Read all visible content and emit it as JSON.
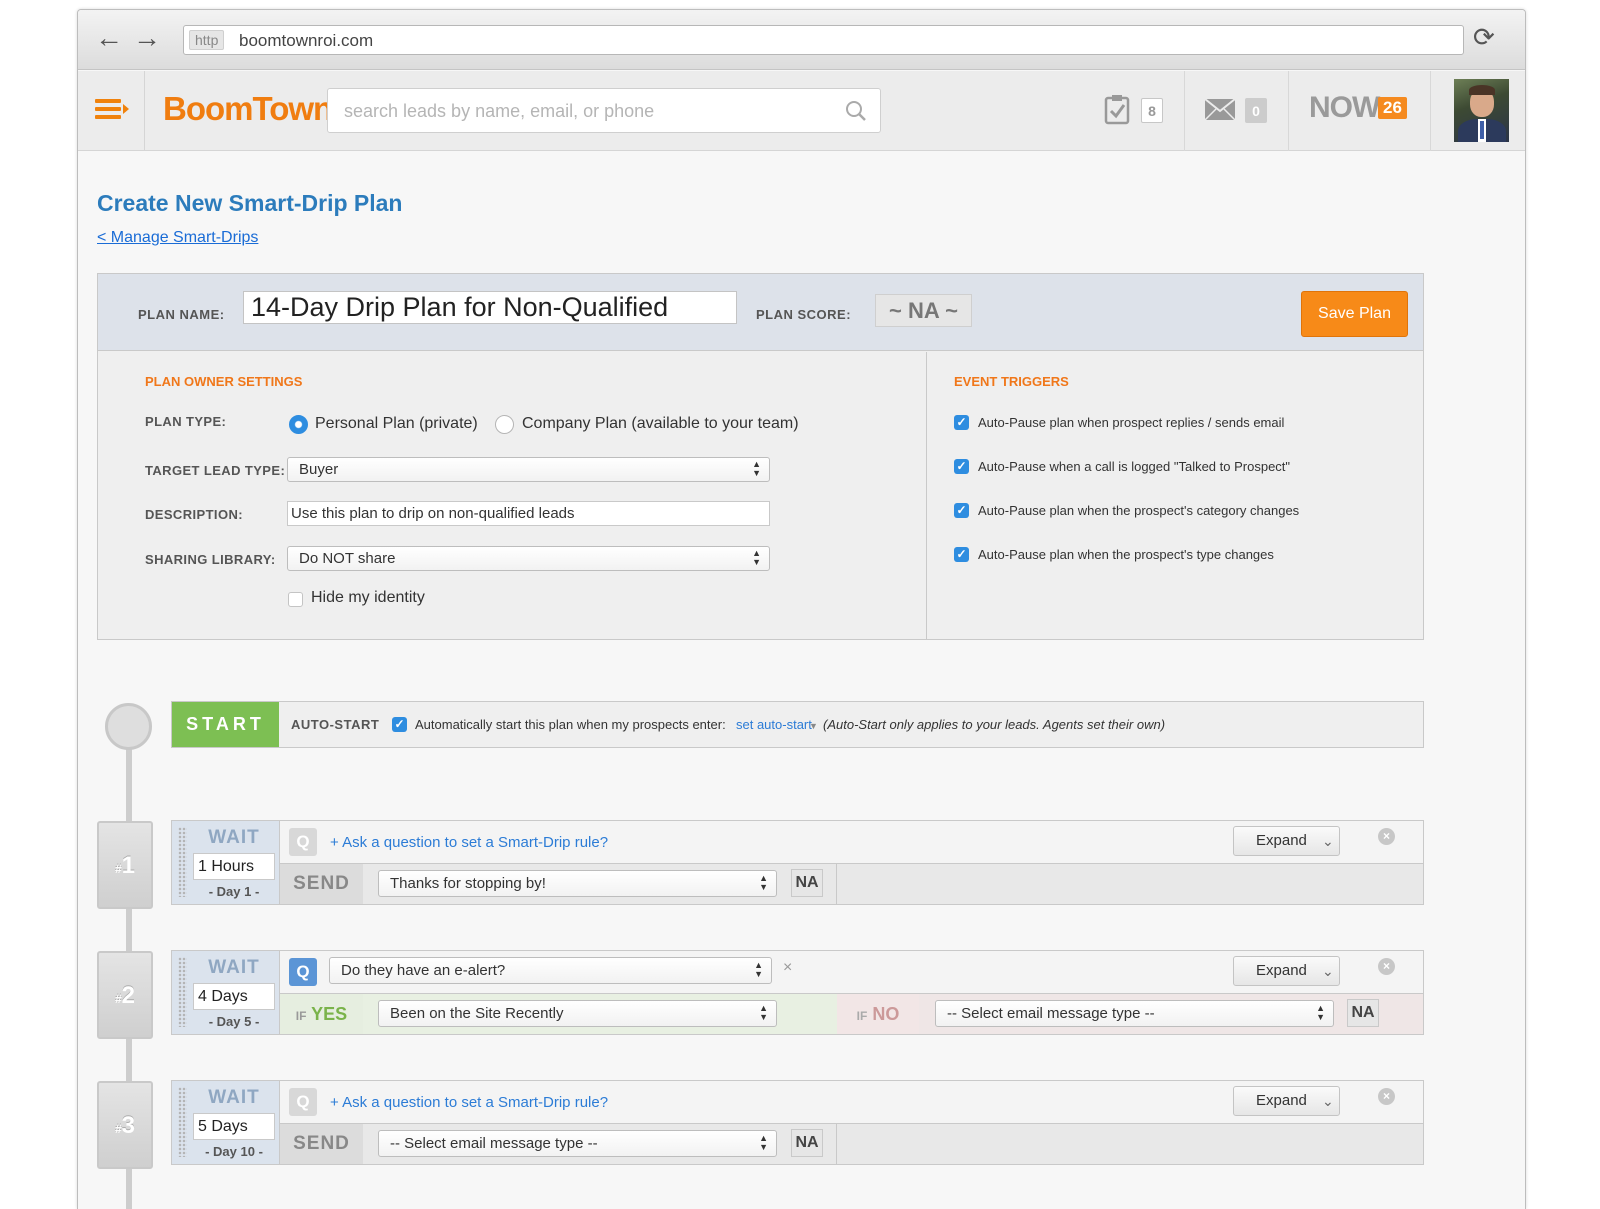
{
  "browser": {
    "protocol": "http",
    "url": "boomtownroi.com",
    "back_icon": "arrow-left",
    "forward_icon": "arrow-right",
    "reload_icon": "reload"
  },
  "header": {
    "logo": "BoomTown!",
    "search_placeholder": "search leads by name, email, or phone",
    "tasks_count": "8",
    "messages_count": "0",
    "now_label": "NOW",
    "now_count": "26"
  },
  "page": {
    "title": "Create New Smart-Drip Plan",
    "back_link": "< Manage Smart-Drips"
  },
  "plan": {
    "name_label": "PLAN NAME:",
    "name_value": "14-Day Drip Plan for Non-Qualified",
    "score_label": "PLAN SCORE:",
    "score_value": "~ NA ~",
    "save_label": "Save Plan"
  },
  "owner_settings": {
    "heading": "PLAN OWNER SETTINGS",
    "plan_type_label": "PLAN TYPE:",
    "plan_type_options": [
      "Personal Plan (private)",
      "Company Plan (available to your team)"
    ],
    "plan_type_selected": 0,
    "target_label": "TARGET LEAD TYPE:",
    "target_value": "Buyer",
    "description_label": "DESCRIPTION:",
    "description_value": "Use this plan to drip on non-qualified leads",
    "sharing_label": "SHARING LIBRARY:",
    "sharing_value": "Do NOT share",
    "hide_identity_label": "Hide my identity",
    "hide_identity_checked": false
  },
  "event_triggers": {
    "heading": "EVENT TRIGGERS",
    "items": [
      {
        "label": "Auto-Pause plan when prospect replies / sends email",
        "checked": true
      },
      {
        "label": "Auto-Pause when a call is logged \"Talked to Prospect\"",
        "checked": true
      },
      {
        "label": "Auto-Pause plan when the prospect's category changes",
        "checked": true
      },
      {
        "label": "Auto-Pause plan when the prospect's type changes",
        "checked": true
      }
    ]
  },
  "start": {
    "button": "START",
    "auto_label": "AUTO-START",
    "auto_text": "Automatically start this plan when my prospects enter:",
    "set_link": "set auto-start",
    "note": "(Auto-Start only applies to your leads. Agents set their own)"
  },
  "steps": [
    {
      "num": "1",
      "wait_label": "WAIT",
      "wait_value": "1 Hours",
      "day": "- Day 1 -",
      "ask": "+ Ask a question to set a Smart-Drip rule?",
      "expand": "Expand",
      "send": "SEND",
      "send_value": "Thanks for stopping by!",
      "na": "NA"
    },
    {
      "num": "2",
      "wait_label": "WAIT",
      "wait_value": "4 Days",
      "day": "- Day 5 -",
      "question": "Do they have an e-alert?",
      "expand": "Expand",
      "if_label": "IF",
      "yes_label": "YES",
      "yes_value": "Been on the Site Recently",
      "no_label": "NO",
      "no_value": "-- Select email message type --",
      "na": "NA"
    },
    {
      "num": "3",
      "wait_label": "WAIT",
      "wait_value": "5 Days",
      "day": "- Day 10 -",
      "ask": "+ Ask a question to set a Smart-Drip rule?",
      "expand": "Expand",
      "send": "SEND",
      "send_value": "-- Select email message type --",
      "na": "NA"
    }
  ],
  "colors": {
    "accent": "#f07d10",
    "link": "#2c7cbc",
    "start": "#7dbf53",
    "check": "#2e8de0"
  }
}
